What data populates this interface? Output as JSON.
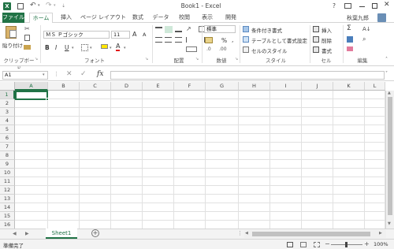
{
  "window": {
    "title": "Book1 - Excel",
    "help": "?",
    "user": "秋葉九郎"
  },
  "tabs": [
    {
      "label": "ファイル"
    },
    {
      "label": "ホーム"
    },
    {
      "label": "挿入"
    },
    {
      "label": "ページ レイアウト"
    },
    {
      "label": "数式"
    },
    {
      "label": "データ"
    },
    {
      "label": "校閲"
    },
    {
      "label": "表示"
    },
    {
      "label": "開発"
    }
  ],
  "ribbon": {
    "clipboard": {
      "paste": "貼り付け",
      "label": "クリップボード"
    },
    "font": {
      "name": "ＭＳ Ｐゴシック",
      "size": "11",
      "bold": "B",
      "italic": "I",
      "underline": "U",
      "grow": "A",
      "shrink": "A",
      "color_letter": "A",
      "label": "フォント"
    },
    "alignment": {
      "label": "配置"
    },
    "number": {
      "format": "標準",
      "percent": "%",
      "comma": ",",
      "label": "数値"
    },
    "styles": {
      "conditional": "条件付き書式",
      "table": "テーブルとして書式設定",
      "cell": "セルのスタイル",
      "label": "スタイル"
    },
    "cells": {
      "insert": "挿入",
      "delete": "削除",
      "format": "書式",
      "label": "セル"
    },
    "editing": {
      "label": "編集"
    }
  },
  "formula_bar": {
    "name_box": "A1",
    "fx": "fx",
    "formula": ""
  },
  "grid": {
    "columns": [
      "A",
      "B",
      "C",
      "D",
      "E",
      "F",
      "G",
      "H",
      "I",
      "J",
      "K",
      "L"
    ],
    "rows": [
      "1",
      "2",
      "3",
      "4",
      "5",
      "6",
      "7",
      "8",
      "9",
      "10",
      "11",
      "12",
      "13",
      "14",
      "15",
      "16"
    ],
    "selected_cell": "A1"
  },
  "sheets": [
    {
      "name": "Sheet1",
      "active": true
    }
  ],
  "status": {
    "ready": "準備完了",
    "zoom": "100%"
  },
  "colors": {
    "excel_green": "#217346",
    "selection": "#217346"
  }
}
